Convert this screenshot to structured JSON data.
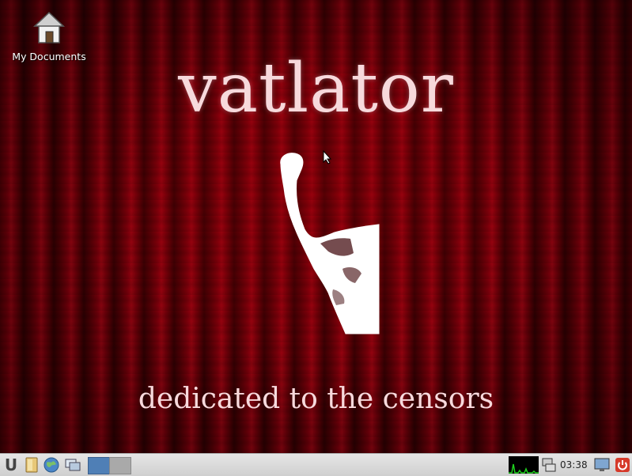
{
  "desktop": {
    "icons": [
      {
        "label": "My Documents",
        "icon": "home-icon"
      }
    ],
    "wallpaper": {
      "title": "vatlator",
      "tagline": "dedicated to the censors",
      "colors": {
        "background": "#5c0008",
        "text": "#f7d9dc"
      }
    }
  },
  "taskbar": {
    "clock": "03:38",
    "items": [
      "menu-icon",
      "file-manager-icon",
      "browser-icon",
      "show-desktop-icon",
      "workspace-1",
      "workspace-2",
      "cpu-monitor",
      "network-icon",
      "display-icon",
      "power-icon"
    ],
    "colors": {
      "workspace_active": "#4f7fb6",
      "workspace_inactive": "#a9a9a9",
      "power": "#d63a2a"
    }
  }
}
